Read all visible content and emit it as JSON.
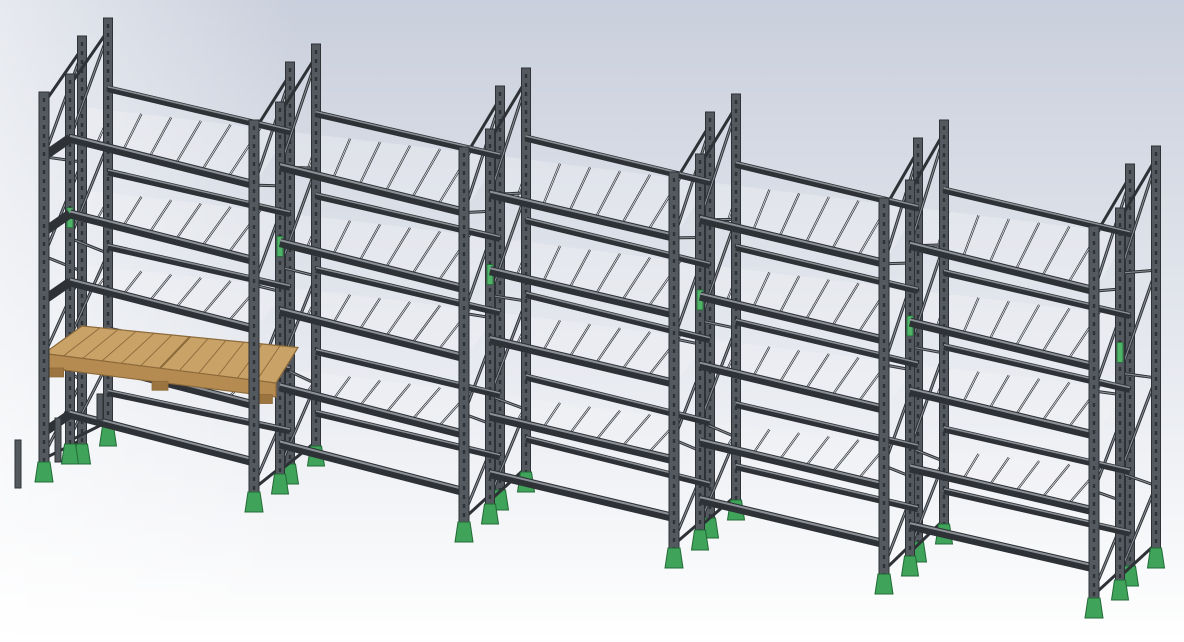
{
  "scene": {
    "subject": "pallet-rack-assembly",
    "colors": {
      "background_top": "#c9cfdc",
      "background_bottom": "#ffffff",
      "steel": "#54595f",
      "steel_dark": "#2e3236",
      "steel_light": "#8b9097",
      "foot_plate": "#3fa35a",
      "spacer": "#4fb467",
      "pallet": "#c9a268",
      "pallet_dark": "#8d6a3a"
    }
  }
}
